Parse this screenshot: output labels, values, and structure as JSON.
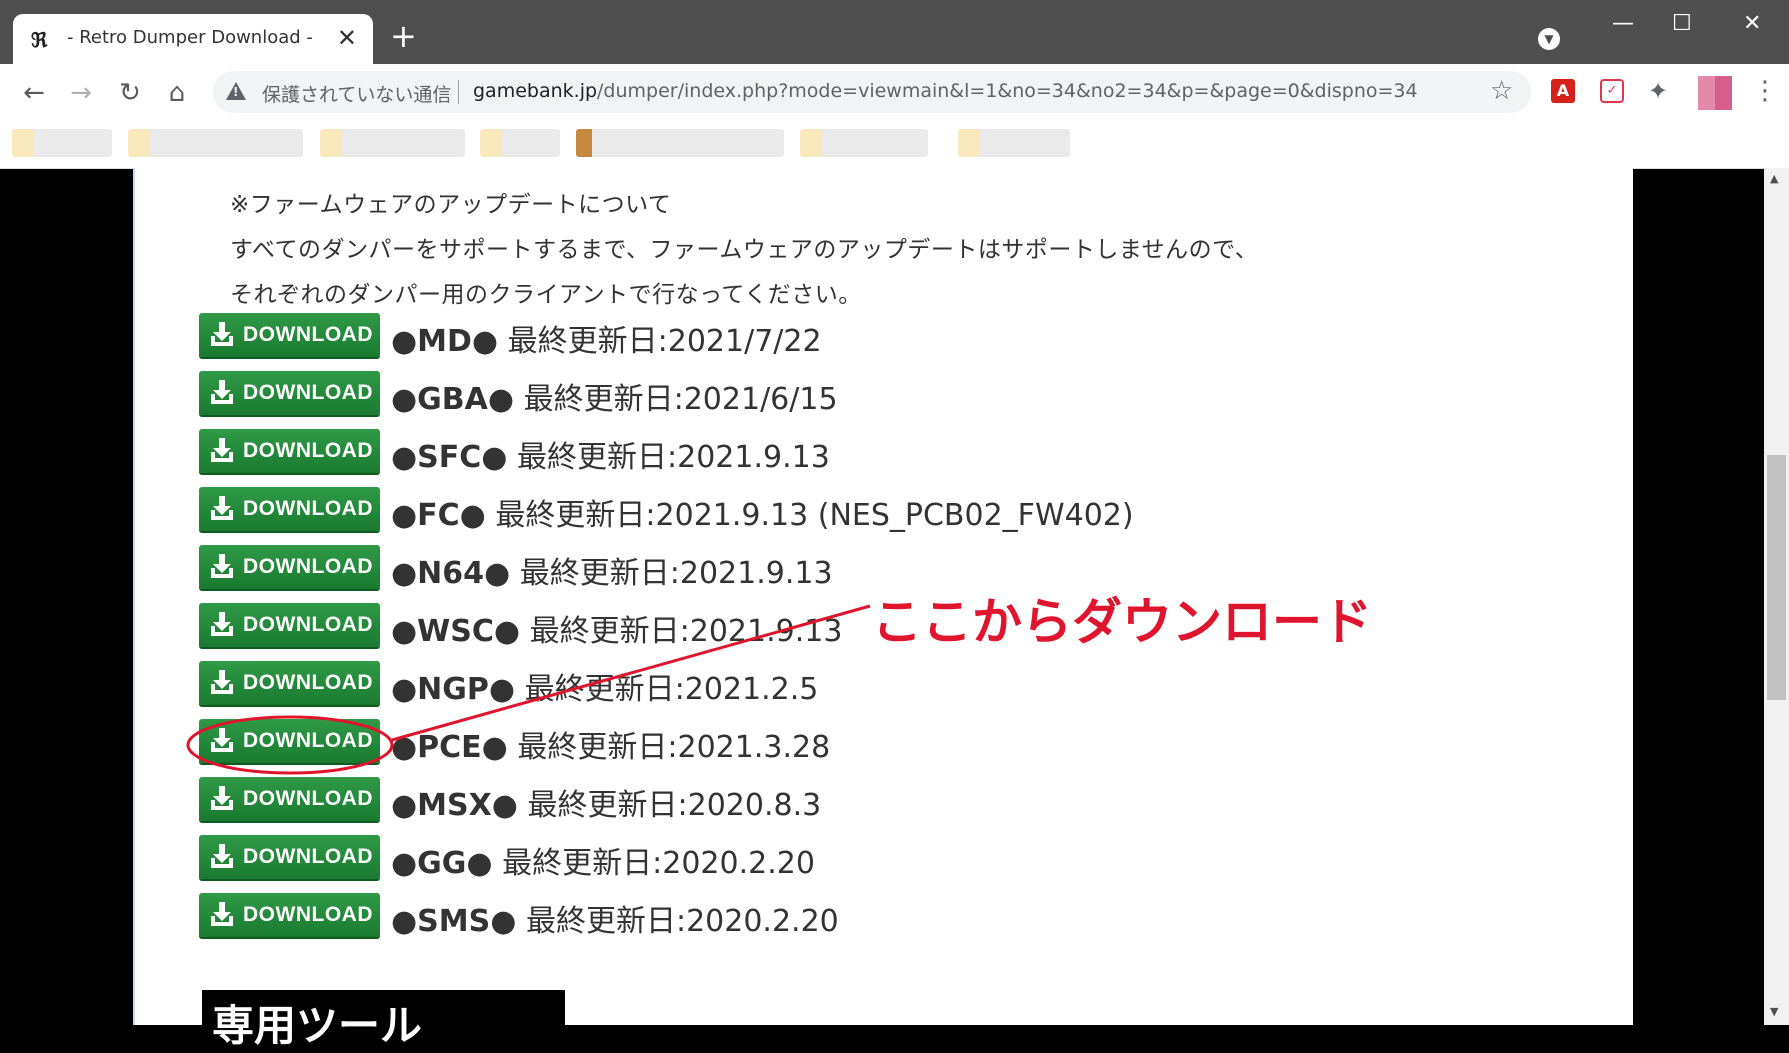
{
  "browser": {
    "tab_title": "- Retro Dumper Download -",
    "favicon_text": "ℜ",
    "new_tab": "+",
    "close": "✕",
    "security_label": "保護されていない通信",
    "url_host": "gamebank.jp",
    "url_path": "/dumper/index.php?mode=viewmain&l=1&no=34&no2=34&p=&page=0&dispno=34",
    "window_min": "—",
    "window_max": "☐",
    "window_close": "✕",
    "back": "←",
    "forward": "→",
    "reload": "↻",
    "home": "⌂",
    "star": "☆",
    "puzzle": "✦",
    "menu": "⋮",
    "pdf_ext": "A",
    "pocket_ext": "✓",
    "profile_dropdown": "▼"
  },
  "page": {
    "notes": [
      "※ファームウェアのアップデートについて",
      "すべてのダンパーをサポートするまで、ファームウェアのアップデートはサポートしませんので、",
      "それぞれのダンパー用のクライアントで行なってください。"
    ],
    "download_label": "DOWNLOAD",
    "downloads": [
      {
        "system": "●MD●",
        "date": "最終更新日:2021/7/22"
      },
      {
        "system": "●GBA●",
        "date": "最終更新日:2021/6/15"
      },
      {
        "system": "●SFC●",
        "date": "最終更新日:2021.9.13"
      },
      {
        "system": "●FC●",
        "date": "最終更新日:2021.9.13 (NES_PCB02_FW402)"
      },
      {
        "system": "●N64●",
        "date": "最終更新日:2021.9.13"
      },
      {
        "system": "●WSC●",
        "date": "最終更新日:2021.9.13"
      },
      {
        "system": "●NGP●",
        "date": "最終更新日:2021.2.5"
      },
      {
        "system": "●PCE●",
        "date": "最終更新日:2021.3.28"
      },
      {
        "system": "●MSX●",
        "date": "最終更新日:2020.8.3"
      },
      {
        "system": "●GG●",
        "date": "最終更新日:2020.2.20"
      },
      {
        "system": "●SMS●",
        "date": "最終更新日:2020.2.20"
      }
    ],
    "heading_partial": "専用ツール"
  },
  "annotation": {
    "text": "ここからダウンロード",
    "color": "#e0142c"
  },
  "colors": {
    "download_green": "#1f8a38",
    "titlebar": "#4f4f4f"
  }
}
